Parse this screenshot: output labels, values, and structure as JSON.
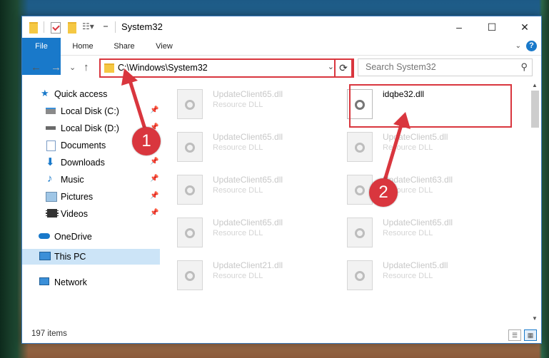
{
  "window": {
    "title": "System32",
    "controls": {
      "minimize": "–",
      "maximize": "☐",
      "close": "✕"
    }
  },
  "ribbon": {
    "tabs": [
      "File",
      "Home",
      "Share",
      "View"
    ],
    "help": "?"
  },
  "navigation": {
    "back": "←",
    "forward": "→",
    "recent": "⌄",
    "up": "↑",
    "address": "C:\\Windows\\System32",
    "search_placeholder": "Search System32"
  },
  "sidebar": {
    "items": [
      {
        "label": "Quick access",
        "icon": "star-icon",
        "pinned": false
      },
      {
        "label": "Local Disk (C:)",
        "icon": "drive-icon",
        "pinned": true
      },
      {
        "label": "Local Disk (D:)",
        "icon": "drive-icon",
        "pinned": true
      },
      {
        "label": "Documents",
        "icon": "documents-icon",
        "pinned": true
      },
      {
        "label": "Downloads",
        "icon": "downloads-icon",
        "pinned": true
      },
      {
        "label": "Music",
        "icon": "music-icon",
        "pinned": true
      },
      {
        "label": "Pictures",
        "icon": "pictures-icon",
        "pinned": true
      },
      {
        "label": "Videos",
        "icon": "videos-icon",
        "pinned": true
      },
      {
        "label": "OneDrive",
        "icon": "cloud-icon",
        "pinned": false
      },
      {
        "label": "This PC",
        "icon": "computer-icon",
        "pinned": false,
        "selected": true
      },
      {
        "label": "Network",
        "icon": "network-icon",
        "pinned": false
      }
    ]
  },
  "files": {
    "left": [
      {
        "name": "UpdateClient65.dll",
        "type": "Resource DLL"
      },
      {
        "name": "UpdateClient65.dll",
        "type": "Resource DLL"
      },
      {
        "name": "UpdateClient65.dll",
        "type": "Resource DLL"
      },
      {
        "name": "UpdateClient65.dll",
        "type": "Resource DLL"
      },
      {
        "name": "UpdateClient21.dll",
        "type": "Resource DLL"
      }
    ],
    "right": [
      {
        "name": "idqbe32.dll",
        "type": ""
      },
      {
        "name": "UpdateClient5.dll",
        "type": "Resource DLL"
      },
      {
        "name": "UpdateClient63.dll",
        "type": "Resource DLL"
      },
      {
        "name": "UpdateClient65.dll",
        "type": "Resource DLL"
      },
      {
        "name": "UpdateClient5.dll",
        "type": "Resource DLL"
      }
    ]
  },
  "status": {
    "item_count": "197 items"
  },
  "annotations": {
    "step1": "1",
    "step2": "2",
    "highlight_color": "#d9363e"
  },
  "colors": {
    "accent": "#1979ca",
    "selection": "#cce4f7"
  }
}
